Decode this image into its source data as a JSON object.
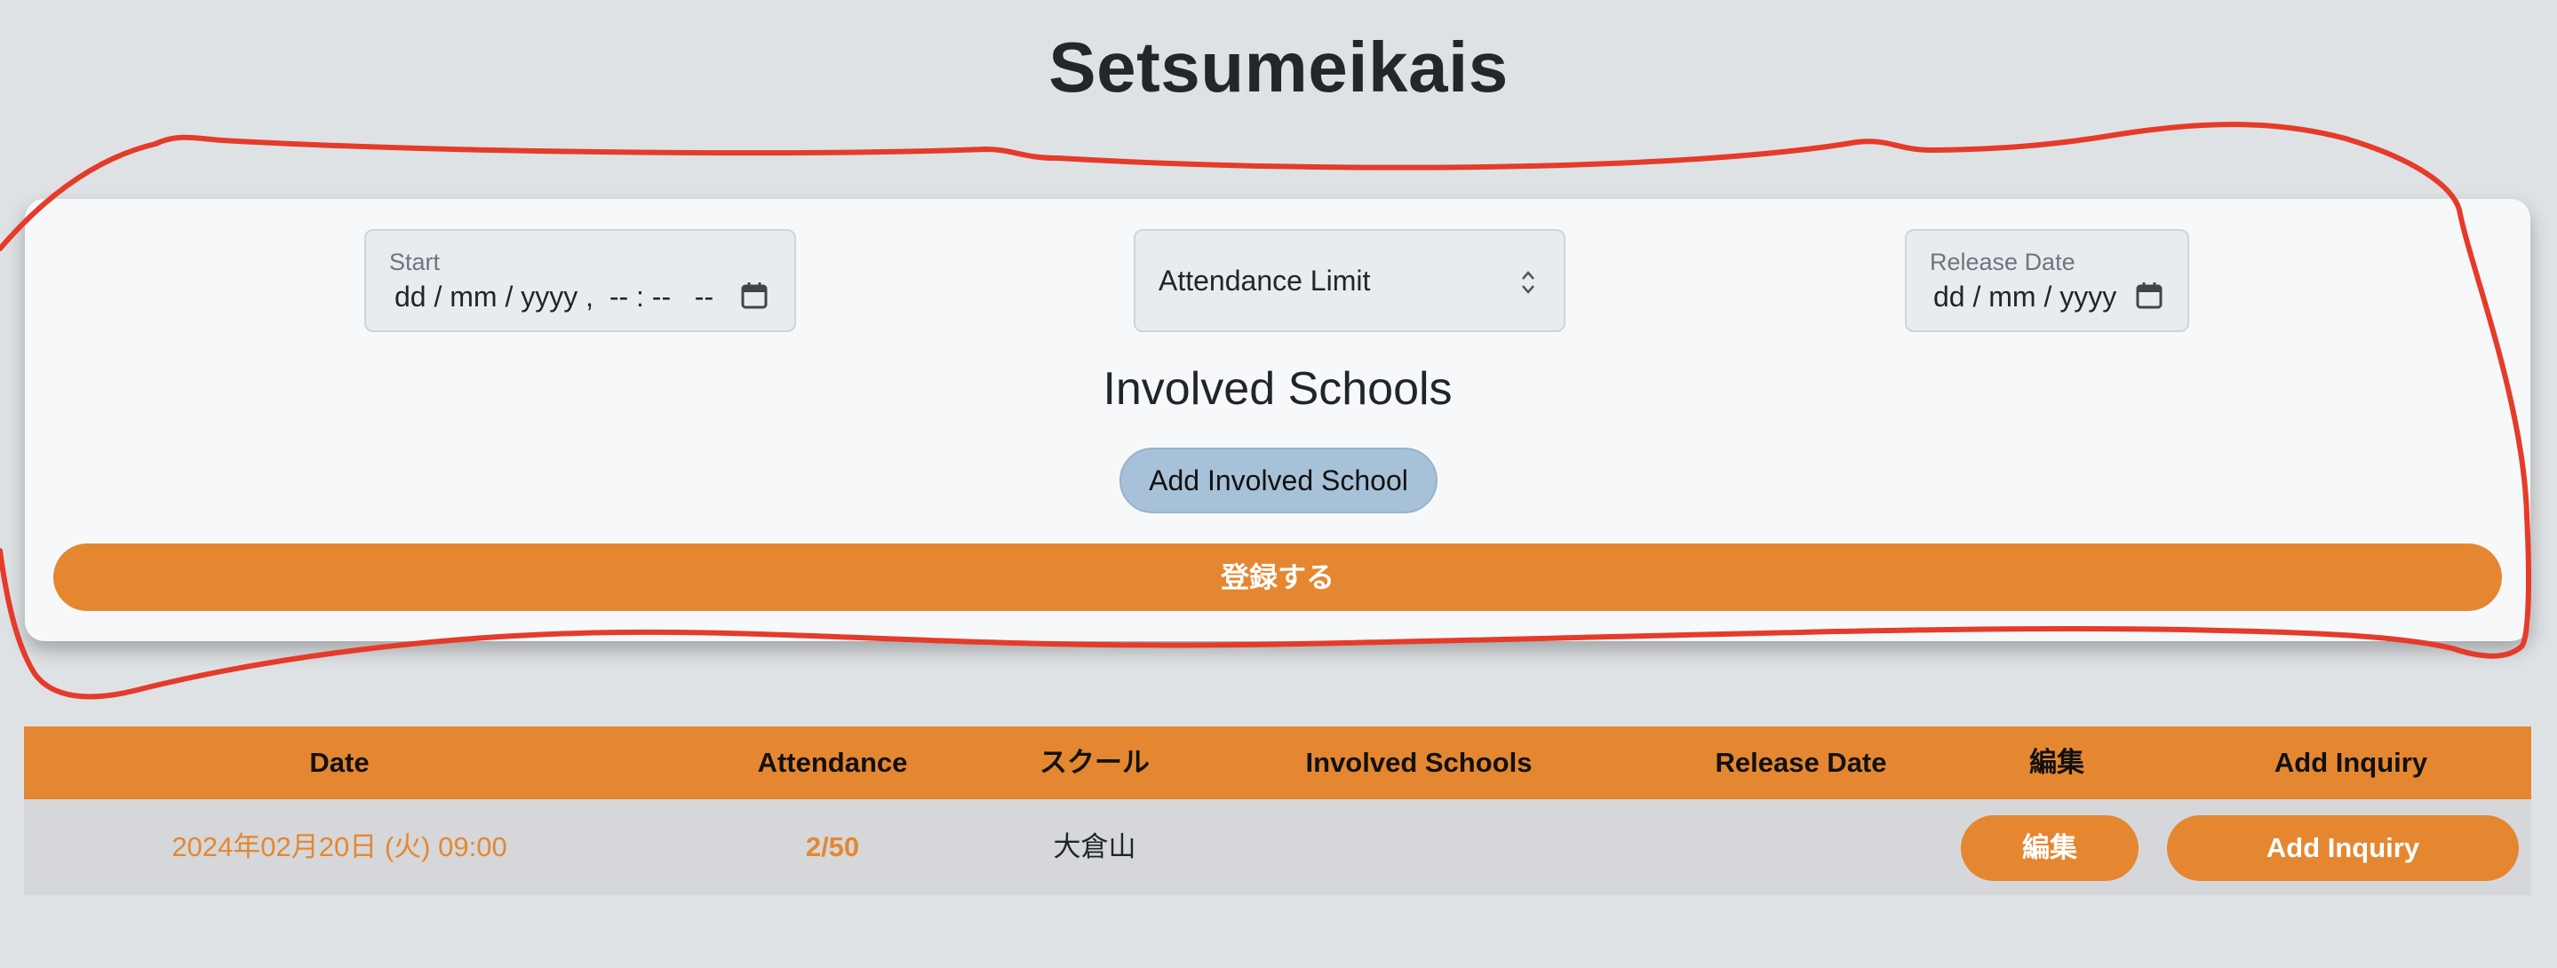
{
  "page": {
    "title": "Setsumeikais"
  },
  "form": {
    "start": {
      "label": "Start",
      "value": "dd / mm / yyyy ,  -- : --   --"
    },
    "attendance_limit": {
      "placeholder": "Attendance Limit"
    },
    "release_date": {
      "label": "Release Date",
      "value": "dd / mm / yyyy"
    },
    "involved_schools_heading": "Involved Schools",
    "add_school_label": "Add Involved School",
    "submit_label": "登録する"
  },
  "table": {
    "headers": [
      "Date",
      "Attendance",
      "スクール",
      "Involved Schools",
      "Release Date",
      "編集",
      "Add Inquiry"
    ],
    "rows": [
      {
        "date": "2024年02月20日 (火) 09:00",
        "attendance": "2/50",
        "school": "大倉山",
        "involved_schools": "",
        "release_date": "",
        "edit_label": "編集",
        "inquiry_label": "Add Inquiry"
      }
    ]
  },
  "colors": {
    "accent": "#e58731",
    "background": "#dfe2e5",
    "card": "#f7f8fa",
    "secondary_button": "#a7c1d8",
    "annotation": "#e53b2a"
  },
  "icons": [
    "calendar-icon",
    "select-arrows-icon"
  ]
}
